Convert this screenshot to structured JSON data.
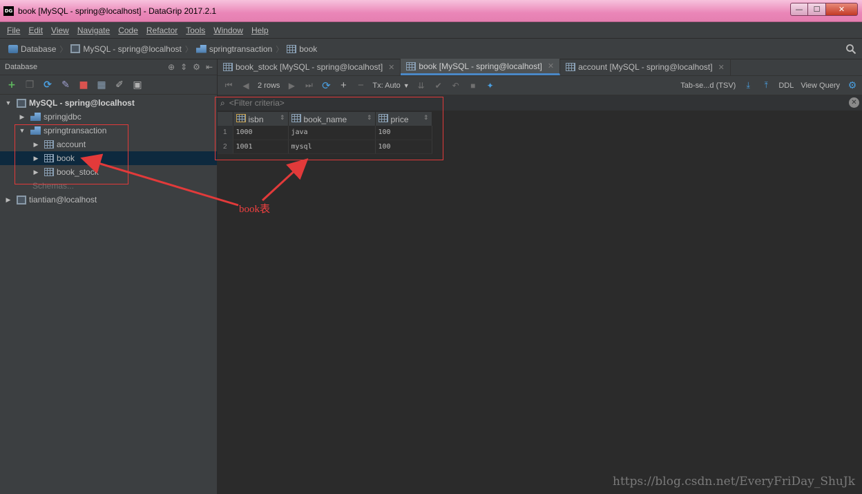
{
  "window": {
    "title": "book [MySQL - spring@localhost] - DataGrip 2017.2.1",
    "logo": "DG",
    "min": "—",
    "max": "☐",
    "close": "✕"
  },
  "menu": [
    "File",
    "Edit",
    "View",
    "Navigate",
    "Code",
    "Refactor",
    "Tools",
    "Window",
    "Help"
  ],
  "breadcrumb": [
    "Database",
    "MySQL - spring@localhost",
    "springtransaction",
    "book"
  ],
  "sidebar": {
    "title": "Database",
    "tree": [
      {
        "label": "MySQL - spring@localhost",
        "level": 0,
        "icon": "datasource-icon",
        "arrow": "▼"
      },
      {
        "label": "springjdbc",
        "level": 1,
        "icon": "schema-icon",
        "arrow": "▶"
      },
      {
        "label": "springtransaction",
        "level": 1,
        "icon": "schema-icon",
        "arrow": "▼"
      },
      {
        "label": "account",
        "level": 2,
        "icon": "table-icon",
        "arrow": "▶"
      },
      {
        "label": "book",
        "level": 2,
        "icon": "table-icon",
        "arrow": "▶"
      },
      {
        "label": "book_stock",
        "level": 2,
        "icon": "table-icon",
        "arrow": "▶"
      },
      {
        "label": "Schemas...",
        "level": 1,
        "icon": "",
        "arrow": ""
      },
      {
        "label": "tiantian@localhost",
        "level": 0,
        "icon": "datasource-icon",
        "arrow": "▶"
      }
    ]
  },
  "tabs": [
    {
      "label": "book_stock [MySQL - spring@localhost]",
      "active": false
    },
    {
      "label": "book [MySQL - spring@localhost]",
      "active": true
    },
    {
      "label": "account [MySQL - spring@localhost]",
      "active": false
    }
  ],
  "toolbar": {
    "rows": "2 rows",
    "tx": "Tx: Auto",
    "format": "Tab-se...d (TSV)",
    "ddl": "DDL",
    "view_query": "View Query"
  },
  "filter": {
    "placeholder": "<Filter criteria>"
  },
  "grid": {
    "columns": [
      "isbn",
      "book_name",
      "price"
    ],
    "rows": [
      {
        "n": "1",
        "cells": [
          "1000",
          "java",
          "100"
        ]
      },
      {
        "n": "2",
        "cells": [
          "1001",
          "mysql",
          "100"
        ]
      }
    ]
  },
  "annotation": "book表",
  "watermark": "https://blog.csdn.net/EveryFriDay_ShuJk",
  "colors": {
    "accent": "#4a88c7",
    "annotation": "#e23a3a",
    "selection": "#0d293e"
  }
}
